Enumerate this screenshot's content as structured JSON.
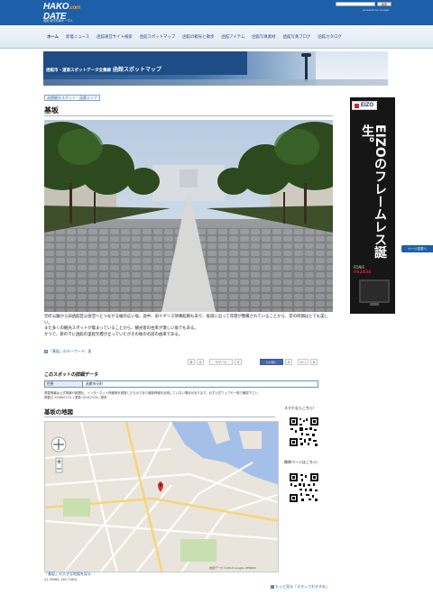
{
  "header": {
    "logo_main": "HAKO",
    "logo_com": ".com",
    "logo_sub": "DATE",
    "logo_tagline": "函館 観光情報ポータル",
    "search_button": "検索",
    "powered_by": "powered by Google"
  },
  "nav": {
    "items": [
      "ホーム",
      "新着ニュース",
      "函館運営サイト検索",
      "函館スポットマップ",
      "函館の観光と散歩",
      "函館アイテム",
      "函館写真素材",
      "函館写真ブログ",
      "函館カタログ"
    ]
  },
  "banner": {
    "subtitle": "函館市・道南スポットデータ全集録",
    "title": "函館スポットマップ"
  },
  "breadcrumb": "函館観光スポット・函館エリア",
  "page_title": "基坂",
  "description": [
    "元町公園から旧函館区公会堂へとつながる幅の広い坂。途中、旧イギリス領事館跡もあり、坂道に沿って花壇が整備されていることから、花の時期はとても美しい。",
    "また多くの観光スポットが集まっていることから、観光客の往来が激しい坂でもある。",
    "かつて、新の下に函館の里程元標が立っていたがその後の名前の由来である。"
  ],
  "keyword": {
    "label": "「基坂」のキーワード:",
    "value": "坂"
  },
  "social": {
    "hatena_count": "0",
    "tweet": "ツイート",
    "tweet_count": "0",
    "like": "いいね！",
    "like_count": "0",
    "gplus": "8+1",
    "gplus_count": "0"
  },
  "detail": {
    "heading": "このスポットの詳細データ",
    "address_label": "住所",
    "address_value": "函館市元町",
    "notice": "掲載情報は公式情報や新聞社、インターネット情報等を調査したものであり最新情報を反映していない場合があります。必ず公式ウェブや一般で確認下さい",
    "notice2": "掲載日 2008/07/11 / 更新 2014/7/14 / 優良"
  },
  "map_section": {
    "heading": "基坂の地図",
    "link": "「基坂」の大きな地図を見る",
    "coords": "41.76565, 140.71601",
    "copyright": "地図データ ©2014 Google, ZENRIN"
  },
  "sidebar": {
    "smartphone_label": "スマホならこちら！",
    "mobile_label": "携帯ページはこちら！"
  },
  "ad": {
    "brand": "EIZO",
    "headline": "EIZOのフレームレス誕生。",
    "series": "FORIS",
    "model": "FS2434"
  },
  "feedback": "ページ変更へ",
  "footer_link": "もっと見る「スタッフおすすめ」",
  "colors": {
    "header_blue": "#1d5fa8",
    "accent_orange": "#f7a21b",
    "link_blue": "#1d5fa8"
  }
}
